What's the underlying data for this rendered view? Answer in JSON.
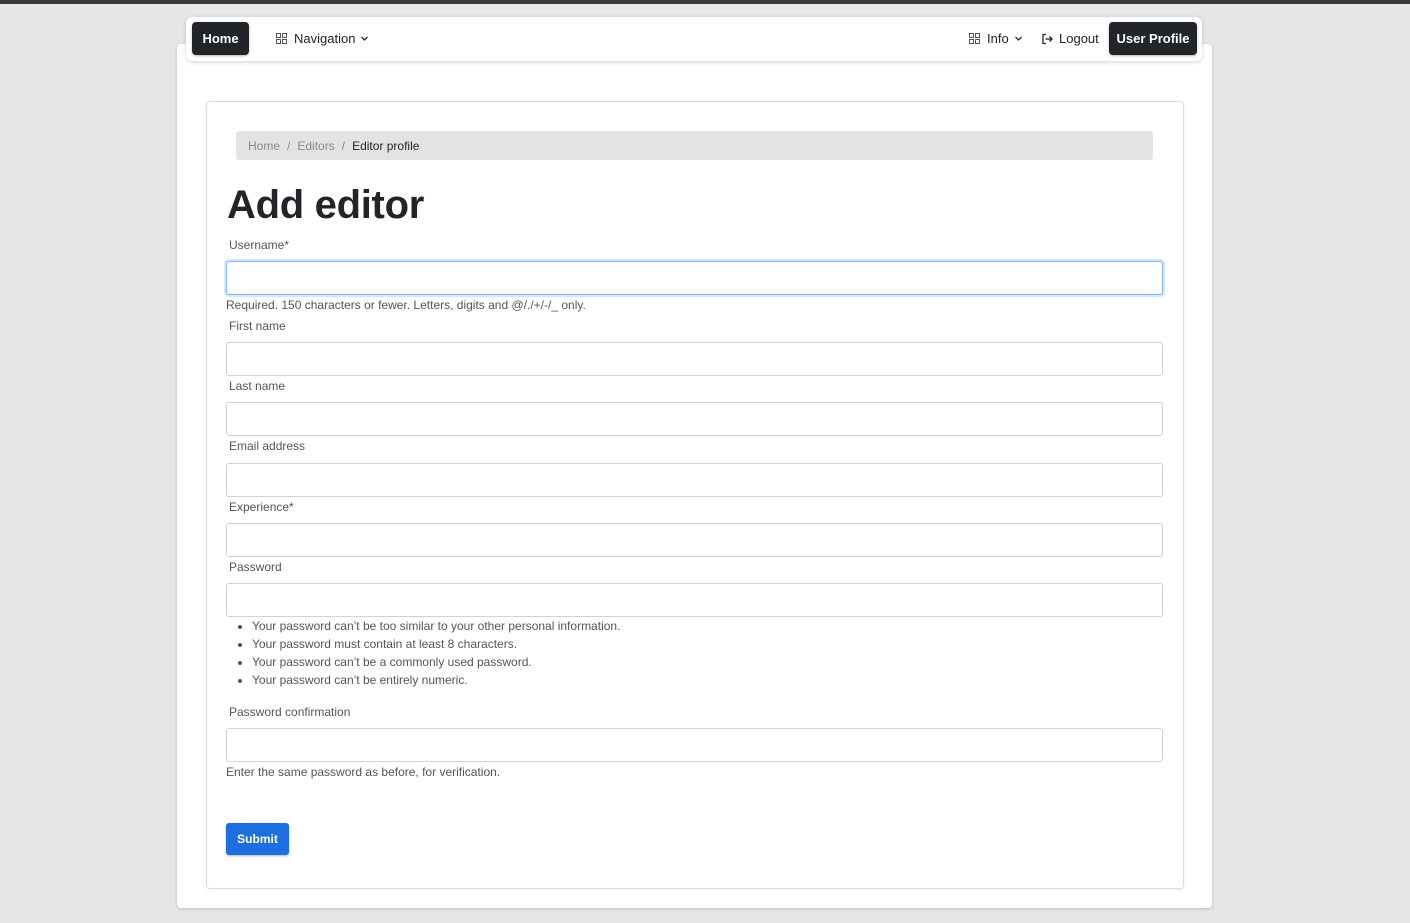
{
  "navbar": {
    "home_label": "Home",
    "navigation_label": "Navigation",
    "info_label": "Info",
    "logout_label": "Logout",
    "user_profile_label": "User Profile"
  },
  "breadcrumb": {
    "items": [
      "Home",
      "Editors"
    ],
    "separator": "/",
    "active": "Editor profile"
  },
  "page_title": "Add editor",
  "form": {
    "username": {
      "label": "Username*",
      "value": "",
      "help": "Required. 150 characters or fewer. Letters, digits and @/./+/-/_ only."
    },
    "first_name": {
      "label": "First name",
      "value": ""
    },
    "last_name": {
      "label": "Last name",
      "value": ""
    },
    "email": {
      "label": "Email address",
      "value": ""
    },
    "experience": {
      "label": "Experience*",
      "value": ""
    },
    "password": {
      "label": "Password",
      "value": "",
      "rules": [
        "Your password can’t be too similar to your other personal information.",
        "Your password must contain at least 8 characters.",
        "Your password can’t be a commonly used password.",
        "Your password can’t be entirely numeric."
      ]
    },
    "password_confirmation": {
      "label": "Password confirmation",
      "value": "",
      "help": "Enter the same password as before, for verification."
    },
    "submit_label": "Submit"
  },
  "icons": {
    "navigation": "grid-icon",
    "navigation_caret": "chevron-down-icon",
    "info": "grid-icon",
    "info_caret": "chevron-down-icon",
    "logout": "logout-icon"
  },
  "colors": {
    "primary": "#1c6fe0",
    "dark": "#212529",
    "background": "#e6e6e6"
  }
}
